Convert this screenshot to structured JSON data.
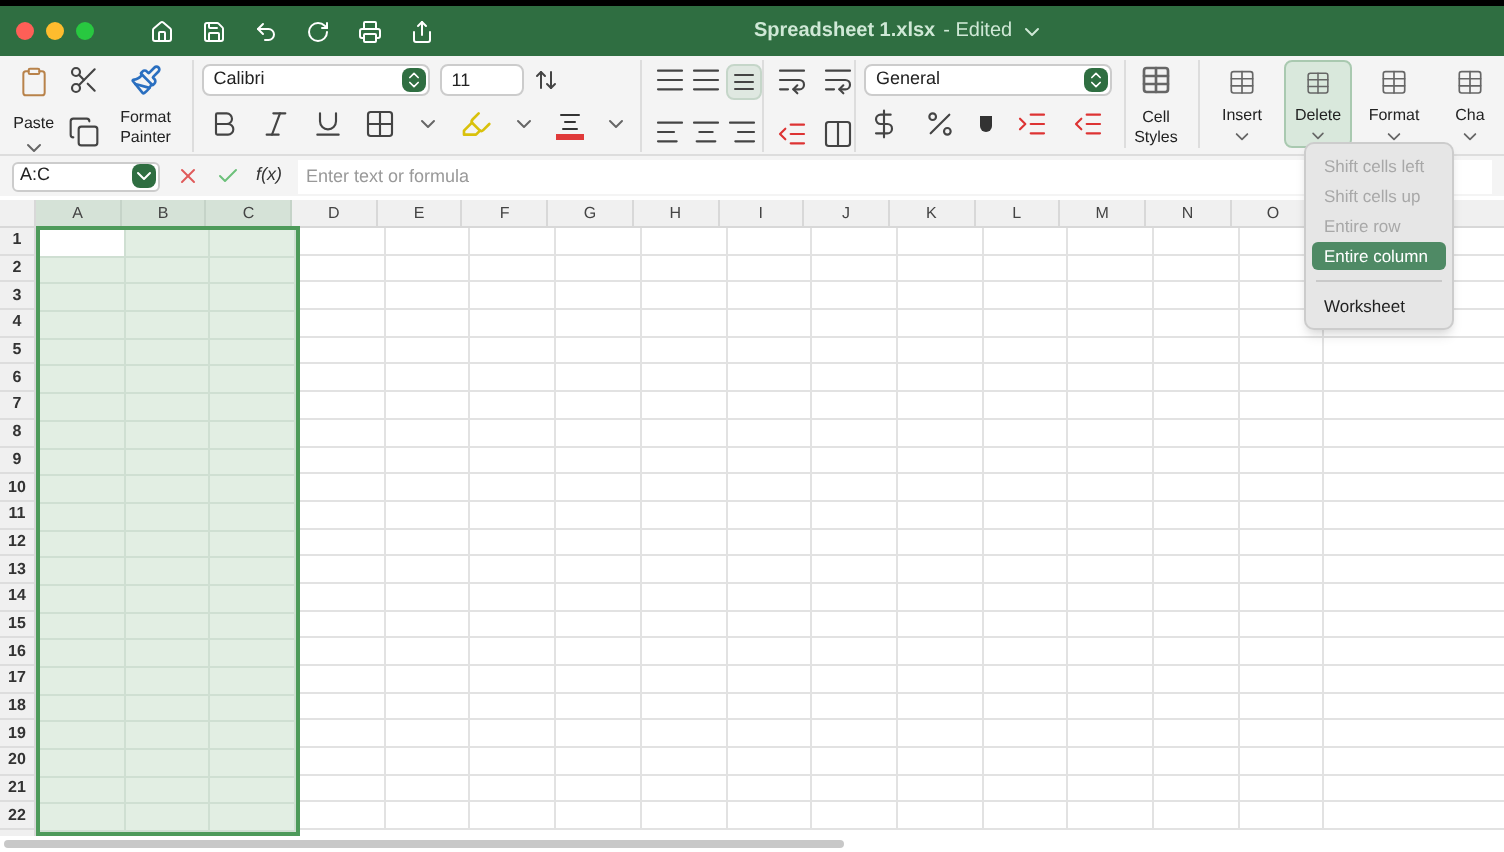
{
  "window": {
    "title": "Spreadsheet 1.xlsx",
    "status": "- Edited"
  },
  "ribbon": {
    "paste": "Paste",
    "format_painter": "Format Painter",
    "font_name": "Calibri",
    "font_size": "11",
    "number_format": "General",
    "cell_styles": "Cell Styles",
    "actions": [
      {
        "label": "Insert",
        "selected": false
      },
      {
        "label": "Delete",
        "selected": true
      },
      {
        "label": "Format",
        "selected": false
      },
      {
        "label": "Cha",
        "selected": false
      }
    ]
  },
  "formula_bar": {
    "name_box": "A:C",
    "fx": "f(x)",
    "placeholder": "Enter text or formula"
  },
  "columns": [
    {
      "label": "A",
      "selected": true
    },
    {
      "label": "B",
      "selected": true
    },
    {
      "label": "C",
      "selected": true
    },
    {
      "label": "D",
      "selected": false
    },
    {
      "label": "E",
      "selected": false
    },
    {
      "label": "F",
      "selected": false
    },
    {
      "label": "G",
      "selected": false
    },
    {
      "label": "H",
      "selected": false
    },
    {
      "label": "I",
      "selected": false
    },
    {
      "label": "J",
      "selected": false
    },
    {
      "label": "K",
      "selected": false
    },
    {
      "label": "L",
      "selected": false
    },
    {
      "label": "M",
      "selected": false
    },
    {
      "label": "N",
      "selected": false
    },
    {
      "label": "O",
      "selected": false
    }
  ],
  "rows": [
    "1",
    "2",
    "3",
    "4",
    "5",
    "6",
    "7",
    "8",
    "9",
    "10",
    "11",
    "12",
    "13",
    "14",
    "15",
    "16",
    "17",
    "18",
    "19",
    "20",
    "21",
    "22"
  ],
  "delete_menu": [
    {
      "kind": "item",
      "label": "Shift cells left",
      "disabled": true,
      "selected": false
    },
    {
      "kind": "item",
      "label": "Shift cells up",
      "disabled": true,
      "selected": false
    },
    {
      "kind": "item",
      "label": "Entire row",
      "disabled": true,
      "selected": false
    },
    {
      "kind": "item",
      "label": "Entire column",
      "disabled": false,
      "selected": true
    },
    {
      "kind": "separator"
    },
    {
      "kind": "item",
      "label": "Worksheet",
      "disabled": false,
      "selected": false
    }
  ]
}
